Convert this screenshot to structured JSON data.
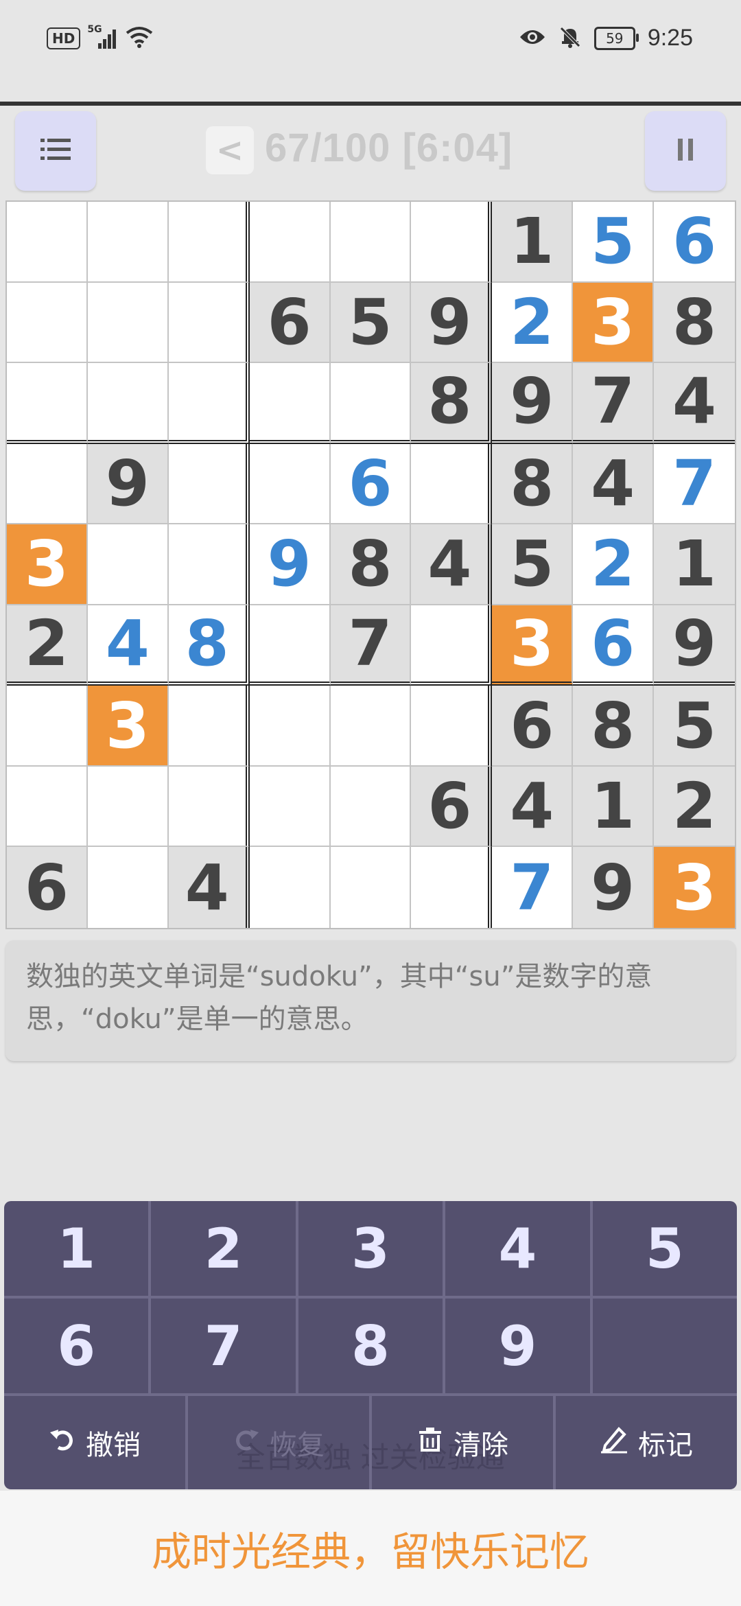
{
  "status_bar": {
    "hd": "HD",
    "signal_label": "5G",
    "battery": "59",
    "time": "9:25",
    "icons": [
      "signal-icon",
      "wifi-icon",
      "eye-icon",
      "mute-bell-icon",
      "battery-icon"
    ]
  },
  "header": {
    "back_label": "<",
    "level_text": "67/100 [6:04]",
    "menu_icon": "list-icon",
    "pause_icon": "pause-icon"
  },
  "board": {
    "rows": [
      [
        {
          "v": "",
          "s": "w"
        },
        {
          "v": "",
          "s": "w"
        },
        {
          "v": "",
          "s": "w"
        },
        {
          "v": "",
          "s": "w"
        },
        {
          "v": "",
          "s": "w"
        },
        {
          "v": "",
          "s": "w"
        },
        {
          "v": "1",
          "s": "g"
        },
        {
          "v": "5",
          "s": "b"
        },
        {
          "v": "6",
          "s": "b"
        }
      ],
      [
        {
          "v": "",
          "s": "w"
        },
        {
          "v": "",
          "s": "w"
        },
        {
          "v": "",
          "s": "w"
        },
        {
          "v": "6",
          "s": "g"
        },
        {
          "v": "5",
          "s": "g"
        },
        {
          "v": "9",
          "s": "g"
        },
        {
          "v": "2",
          "s": "b"
        },
        {
          "v": "3",
          "s": "o"
        },
        {
          "v": "8",
          "s": "g"
        }
      ],
      [
        {
          "v": "",
          "s": "w"
        },
        {
          "v": "",
          "s": "w"
        },
        {
          "v": "",
          "s": "w"
        },
        {
          "v": "",
          "s": "w"
        },
        {
          "v": "",
          "s": "w"
        },
        {
          "v": "8",
          "s": "g"
        },
        {
          "v": "9",
          "s": "g"
        },
        {
          "v": "7",
          "s": "g"
        },
        {
          "v": "4",
          "s": "g"
        }
      ],
      [
        {
          "v": "",
          "s": "w"
        },
        {
          "v": "9",
          "s": "g"
        },
        {
          "v": "",
          "s": "w"
        },
        {
          "v": "",
          "s": "w"
        },
        {
          "v": "6",
          "s": "b"
        },
        {
          "v": "",
          "s": "w"
        },
        {
          "v": "8",
          "s": "g"
        },
        {
          "v": "4",
          "s": "g"
        },
        {
          "v": "7",
          "s": "b"
        }
      ],
      [
        {
          "v": "3",
          "s": "o"
        },
        {
          "v": "",
          "s": "w"
        },
        {
          "v": "",
          "s": "w"
        },
        {
          "v": "9",
          "s": "b"
        },
        {
          "v": "8",
          "s": "g"
        },
        {
          "v": "4",
          "s": "g"
        },
        {
          "v": "5",
          "s": "g"
        },
        {
          "v": "2",
          "s": "b"
        },
        {
          "v": "1",
          "s": "g"
        }
      ],
      [
        {
          "v": "2",
          "s": "g"
        },
        {
          "v": "4",
          "s": "b"
        },
        {
          "v": "8",
          "s": "b"
        },
        {
          "v": "",
          "s": "w"
        },
        {
          "v": "7",
          "s": "g"
        },
        {
          "v": "",
          "s": "w"
        },
        {
          "v": "3",
          "s": "o"
        },
        {
          "v": "6",
          "s": "b"
        },
        {
          "v": "9",
          "s": "g"
        }
      ],
      [
        {
          "v": "",
          "s": "w"
        },
        {
          "v": "3",
          "s": "o"
        },
        {
          "v": "",
          "s": "w"
        },
        {
          "v": "",
          "s": "w"
        },
        {
          "v": "",
          "s": "w"
        },
        {
          "v": "",
          "s": "w"
        },
        {
          "v": "6",
          "s": "g"
        },
        {
          "v": "8",
          "s": "g"
        },
        {
          "v": "5",
          "s": "g"
        }
      ],
      [
        {
          "v": "",
          "s": "w"
        },
        {
          "v": "",
          "s": "w"
        },
        {
          "v": "",
          "s": "w"
        },
        {
          "v": "",
          "s": "w"
        },
        {
          "v": "",
          "s": "w"
        },
        {
          "v": "6",
          "s": "g"
        },
        {
          "v": "4",
          "s": "g"
        },
        {
          "v": "1",
          "s": "g"
        },
        {
          "v": "2",
          "s": "g"
        }
      ],
      [
        {
          "v": "6",
          "s": "g"
        },
        {
          "v": "",
          "s": "w"
        },
        {
          "v": "4",
          "s": "g"
        },
        {
          "v": "",
          "s": "w"
        },
        {
          "v": "",
          "s": "w"
        },
        {
          "v": "",
          "s": "w"
        },
        {
          "v": "7",
          "s": "b"
        },
        {
          "v": "9",
          "s": "g"
        },
        {
          "v": "3",
          "s": "o"
        }
      ]
    ]
  },
  "tip": {
    "text": "数独的英文单词是“sudoku”，其中“su”是数字的意思，“doku”是单一的意思。"
  },
  "keypad": {
    "numbers": [
      "1",
      "2",
      "3",
      "4",
      "5",
      "6",
      "7",
      "8",
      "9",
      ""
    ],
    "actions": {
      "undo_label": "撤销",
      "redo_label": "恢复",
      "clear_label": "清除",
      "mark_label": "标记"
    },
    "ghost_text": "全百数独 过关检验通"
  },
  "footer": {
    "slogan": "成时光经典，留快乐记忆"
  },
  "colors": {
    "accent_orange": "#f0953a",
    "user_blue": "#3b86d1",
    "keypad_bg": "#54506e",
    "button_lavender": "#dcdcf6"
  }
}
